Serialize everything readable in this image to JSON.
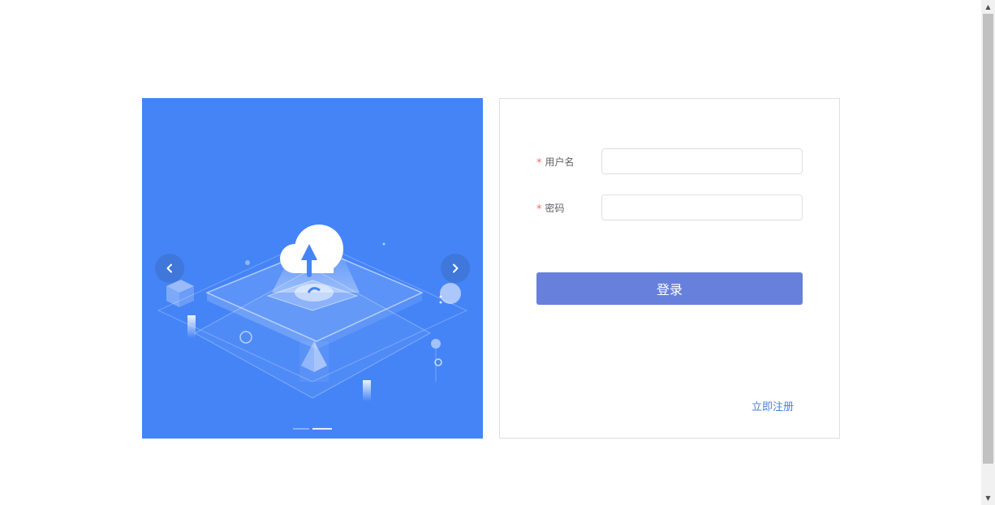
{
  "form": {
    "username_label": "用户名",
    "password_label": "密码",
    "required_mark": "*",
    "username_value": "",
    "password_value": "",
    "login_button": "登录",
    "register_link": "立即注册"
  },
  "carousel": {
    "prev_icon": "chevron-left-icon",
    "next_icon": "chevron-right-icon",
    "slide_count": 2,
    "active_slide": 2,
    "illustration": "cloud-upload-illustration"
  },
  "colors": {
    "carousel_bg": "#4584f7",
    "button_bg": "#6680dc",
    "link": "#4a7fdc",
    "required": "#f56c6c",
    "border": "#dcdfe6"
  }
}
